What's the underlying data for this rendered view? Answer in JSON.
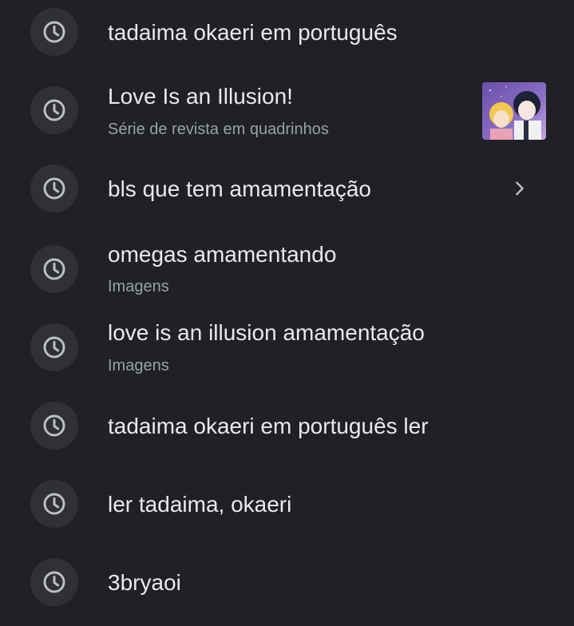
{
  "suggestions": [
    {
      "title": "tadaima okaeri em português",
      "subtitle": "",
      "icon": "history-clock-icon"
    },
    {
      "title": "Love Is an Illusion!",
      "subtitle": "Série de revista em quadrinhos",
      "icon": "history-clock-icon",
      "thumbnail": "manga-cover-thumbnail"
    },
    {
      "title": "bls que tem amamentação",
      "subtitle": "",
      "icon": "history-clock-icon",
      "trailing": "chevron-right-icon"
    },
    {
      "title": "omegas amamentando",
      "subtitle": "Imagens",
      "icon": "history-clock-icon"
    },
    {
      "title": "love is an illusion amamentação",
      "subtitle": "Imagens",
      "icon": "history-clock-icon"
    },
    {
      "title": "tadaima okaeri em português ler",
      "subtitle": "",
      "icon": "history-clock-icon"
    },
    {
      "title": "ler tadaima, okaeri",
      "subtitle": "",
      "icon": "history-clock-icon"
    },
    {
      "title": "3bryaoi",
      "subtitle": "",
      "icon": "history-clock-icon"
    }
  ],
  "colors": {
    "background": "#202124",
    "icon_circle": "#303134",
    "icon_stroke": "#bdc1c6",
    "title_text": "#e8eaed",
    "subtitle_text": "#9aa0a6"
  }
}
